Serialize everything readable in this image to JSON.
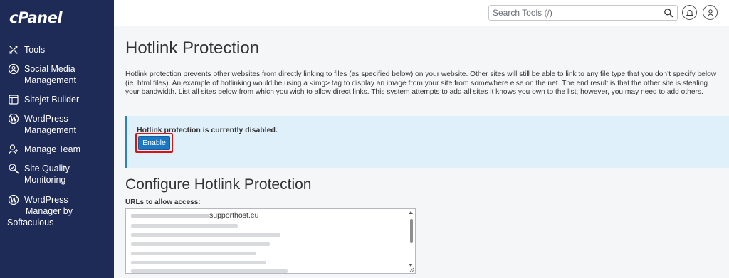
{
  "app": {
    "logo_text": "cPanel"
  },
  "sidebar": {
    "items": [
      {
        "label": "Tools",
        "icon": "tools-icon"
      },
      {
        "label": "Social Media Management",
        "line1": "Social Media",
        "line2": "Management",
        "icon": "social-media-icon"
      },
      {
        "label": "Sitejet Builder",
        "icon": "sitejet-icon"
      },
      {
        "label": "WordPress Management",
        "line1": "WordPress",
        "line2": "Management",
        "icon": "wordpress-icon"
      },
      {
        "label": "Manage Team",
        "icon": "manage-team-icon"
      },
      {
        "label": "Site Quality Monitoring",
        "line1": "Site Quality",
        "line2": "Monitoring",
        "icon": "site-quality-icon"
      },
      {
        "label": "WordPress Manager by Softaculous",
        "line1": "WordPress",
        "line2": "Manager by",
        "line3": "Softaculous",
        "icon": "wordpress-icon"
      }
    ]
  },
  "header": {
    "search_placeholder": "Search Tools (/)",
    "notifications_icon": "bell-icon",
    "user_icon": "user-icon"
  },
  "main": {
    "title": "Hotlink Protection",
    "intro": "Hotlink protection prevents other websites from directly linking to files (as specified below) on your website. Other sites will still be able to link to any file type that you don’t specify below (ie. html files). An example of hotlinking would be using a <img> tag to display an image from your site from somewhere else on the net. The end result is that the other site is stealing your bandwidth. List all sites below from which you wish to allow direct links. This system attempts to add all sites it knows you own to the list; however, you may need to add others.",
    "alert": {
      "message": "Hotlink protection is currently disabled.",
      "enable_label": "Enable"
    },
    "configure_title": "Configure Hotlink Protection",
    "urls_label": "URLs to allow access:",
    "urls_visible": "supporthost.eu"
  },
  "colors": {
    "sidebar_bg": "#1f2b57",
    "alert_bg": "#dff0fa",
    "alert_border": "#2a82c3",
    "enable_button": "#1b78c2",
    "highlight_box": "#dd1111"
  }
}
